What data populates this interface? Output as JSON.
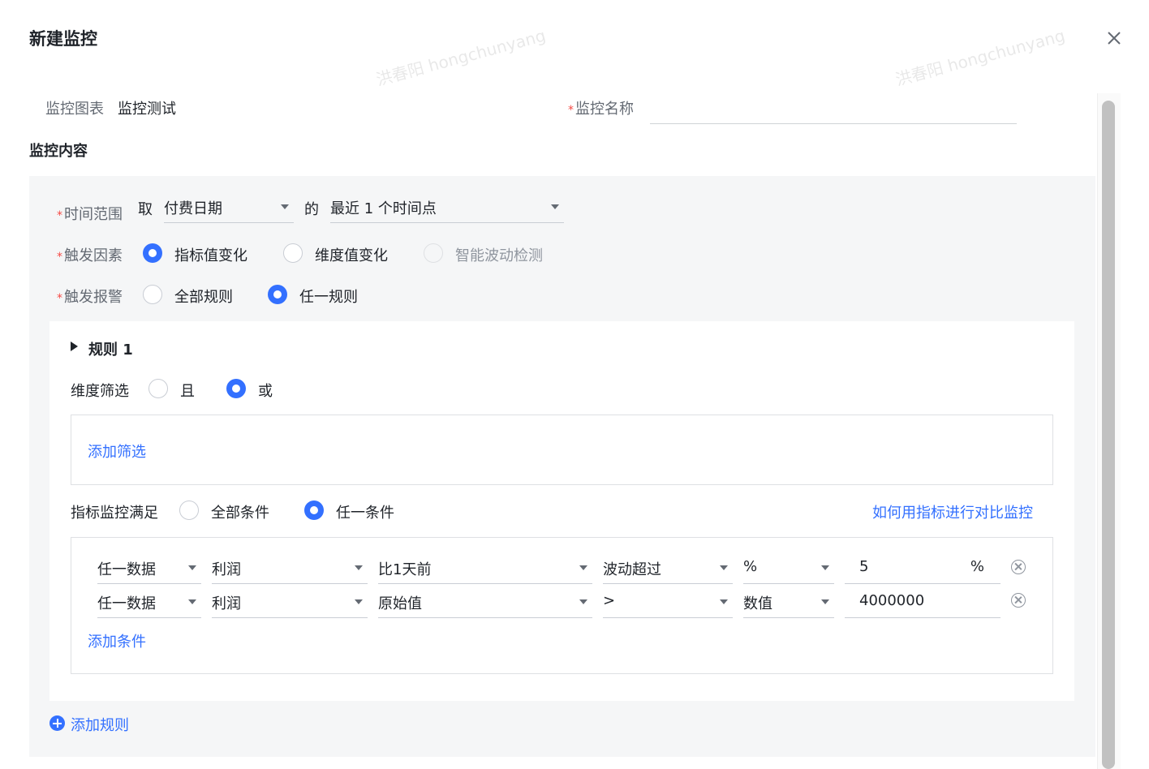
{
  "dialog": {
    "title": "新建监控"
  },
  "watermark": "洪春阳 hongchunyang",
  "chart_row": {
    "label": "监控图表",
    "value": "监控测试",
    "name_label": "监控名称",
    "name_value": ""
  },
  "section": {
    "title": "监控内容"
  },
  "time_range": {
    "label": "时间范围",
    "take": "取",
    "field": "付费日期",
    "of": "的",
    "period": "最近 1 个时间点"
  },
  "trigger_factor": {
    "label": "触发因素",
    "options": [
      "指标值变化",
      "维度值变化",
      "智能波动检测"
    ],
    "selected": "指标值变化"
  },
  "trigger_alarm": {
    "label": "触发报警",
    "options": [
      "全部规则",
      "任一规则"
    ],
    "selected": "任一规则"
  },
  "rule": {
    "title": "规则 1",
    "dim_filter": {
      "label": "维度筛选",
      "options": [
        "且",
        "或"
      ],
      "selected": "或"
    },
    "add_filter": "添加筛选",
    "metric": {
      "label": "指标监控满足",
      "options": [
        "全部条件",
        "任一条件"
      ],
      "selected": "任一条件"
    },
    "help_link": "如何用指标进行对比监控",
    "conditions": [
      {
        "scope": "任一数据",
        "metric": "利润",
        "compare": "比1天前",
        "op": "波动超过",
        "unit": "%",
        "value": "5",
        "suffix": "%"
      },
      {
        "scope": "任一数据",
        "metric": "利润",
        "compare": "原始值",
        "op": ">",
        "unit": "数值",
        "value": "4000000",
        "suffix": ""
      }
    ],
    "add_condition": "添加条件"
  },
  "add_rule": "添加规则",
  "colors": {
    "primary": "#3370ff",
    "required": "#f54a45",
    "panel_bg": "#f5f6f7"
  }
}
